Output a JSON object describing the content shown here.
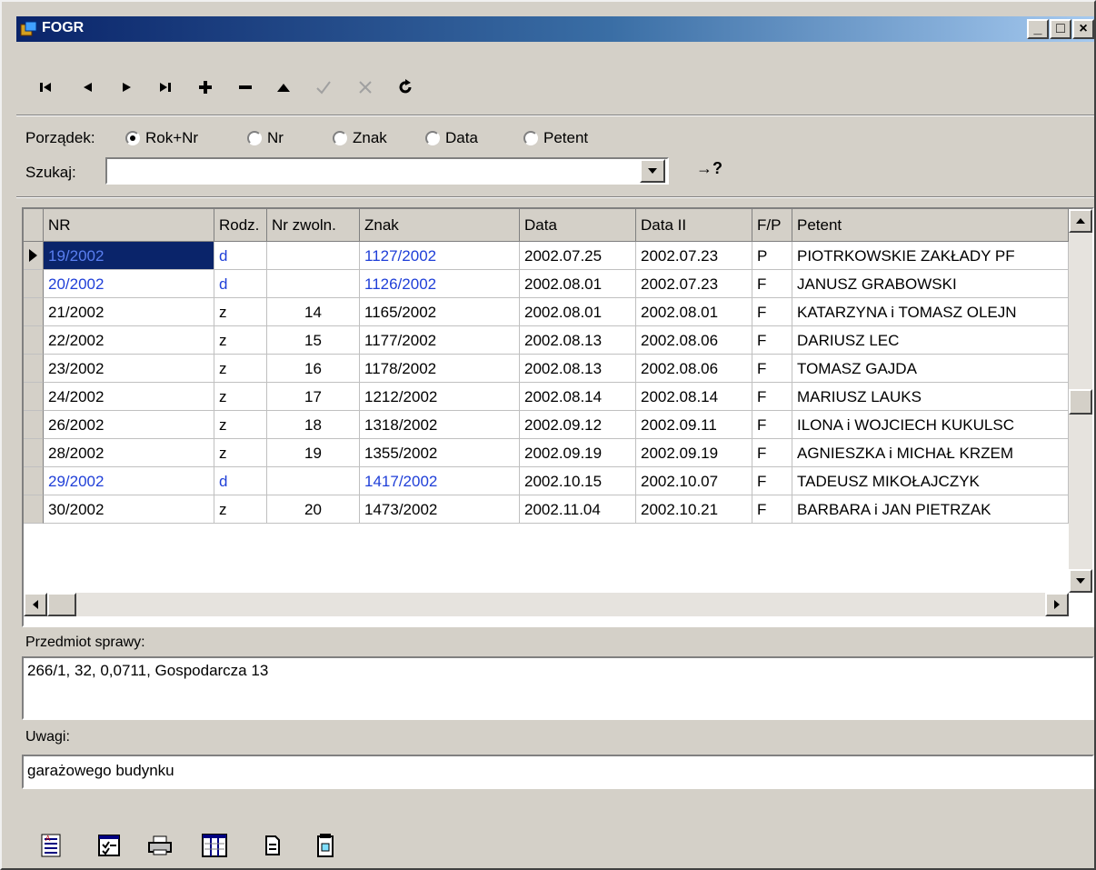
{
  "window": {
    "title": "FOGR",
    "buttons": {
      "minimize": "_",
      "maximize": "□",
      "close": "×"
    }
  },
  "toolbar": {
    "icons": [
      "first-record-icon",
      "prior-record-icon",
      "next-record-icon",
      "last-record-icon",
      "insert-record-icon",
      "delete-record-icon",
      "edit-record-icon",
      "post-record-icon",
      "cancel-record-icon",
      "refresh-icon"
    ],
    "disabled": [
      "post-record-icon",
      "cancel-record-icon"
    ]
  },
  "order": {
    "label": "Porządek:",
    "options": [
      "Rok+Nr",
      "Nr",
      "Znak",
      "Data",
      "Petent"
    ],
    "selected": "Rok+Nr"
  },
  "search": {
    "label": "Szukaj:",
    "value": "",
    "go_label": "→?"
  },
  "grid": {
    "columns": [
      "NR",
      "Rodz.",
      "Nr zwoln.",
      "Znak",
      "Data",
      "Data II",
      "F/P",
      "Petent"
    ],
    "rows": [
      [
        "19/2002",
        "d",
        "",
        "1127/2002",
        "2002.07.25",
        "2002.07.23",
        "P",
        "PIOTRKOWSKIE ZAKŁADY PF"
      ],
      [
        "20/2002",
        "d",
        "",
        "1126/2002",
        "2002.08.01",
        "2002.07.23",
        "F",
        "JANUSZ GRABOWSKI"
      ],
      [
        "21/2002",
        "z",
        "14",
        "1165/2002",
        "2002.08.01",
        "2002.08.01",
        "F",
        "KATARZYNA i TOMASZ OLEJN"
      ],
      [
        "22/2002",
        "z",
        "15",
        "1177/2002",
        "2002.08.13",
        "2002.08.06",
        "F",
        "DARIUSZ  LEC"
      ],
      [
        "23/2002",
        "z",
        "16",
        "1178/2002",
        "2002.08.13",
        "2002.08.06",
        "F",
        "TOMASZ  GAJDA"
      ],
      [
        "24/2002",
        "z",
        "17",
        "1212/2002",
        "2002.08.14",
        "2002.08.14",
        "F",
        "MARIUSZ LAUKS"
      ],
      [
        "26/2002",
        "z",
        "18",
        "1318/2002",
        "2002.09.12",
        "2002.09.11",
        "F",
        "ILONA i WOJCIECH KUKULSC"
      ],
      [
        "28/2002",
        "z",
        "19",
        "1355/2002",
        "2002.09.19",
        "2002.09.19",
        "F",
        "AGNIESZKA i MICHAŁ KRZEM"
      ],
      [
        "29/2002",
        "d",
        "",
        "1417/2002",
        "2002.10.15",
        "2002.10.07",
        "F",
        "TADEUSZ MIKOŁAJCZYK"
      ],
      [
        "30/2002",
        "z",
        "20",
        "1473/2002",
        "2002.11.04",
        "2002.10.21",
        "F",
        "BARBARA i JAN PIETRZAK"
      ]
    ],
    "current_row": 0,
    "highlight_color": "#1f3fd8"
  },
  "subject": {
    "label": "Przedmiot sprawy:",
    "value": "266/1, 32, 0,0711, Gospodarcza 13"
  },
  "notes": {
    "label": "Uwagi:",
    "value": "garażowego budynku"
  },
  "bottom_toolbar": {
    "icons": [
      "report-icon",
      "checklist-icon",
      "print-icon",
      "columns-icon",
      "document-icon",
      "notepad-icon"
    ]
  }
}
